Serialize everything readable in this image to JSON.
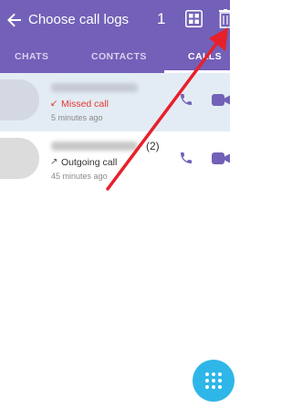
{
  "appbar": {
    "title": "Choose call logs",
    "selected_count": "1",
    "icons": {
      "back": "arrow-left-icon",
      "select_all": "grid-icon",
      "delete": "trash-icon"
    }
  },
  "tabs": [
    {
      "label": "CHATS",
      "active": false
    },
    {
      "label": "CONTACTS",
      "active": false
    },
    {
      "label": "CALLS",
      "active": true
    }
  ],
  "calls": [
    {
      "type": "Missed call",
      "time": "5 minutes ago",
      "count": "",
      "selected": true,
      "direction_icon": "missed-call-arrow-icon",
      "status_color": "#e53935"
    },
    {
      "type": "Outgoing call",
      "time": "45 minutes ago",
      "count": "(2)",
      "selected": false,
      "direction_icon": "outgoing-call-arrow-icon",
      "status_color": "#555555"
    }
  ],
  "colors": {
    "accent": "#7360b8",
    "fab": "#2fb6e8",
    "annotation_arrow": "#e8202a",
    "selected_row": "#e3ecf4"
  },
  "fab": {
    "icon": "dialpad-icon"
  }
}
